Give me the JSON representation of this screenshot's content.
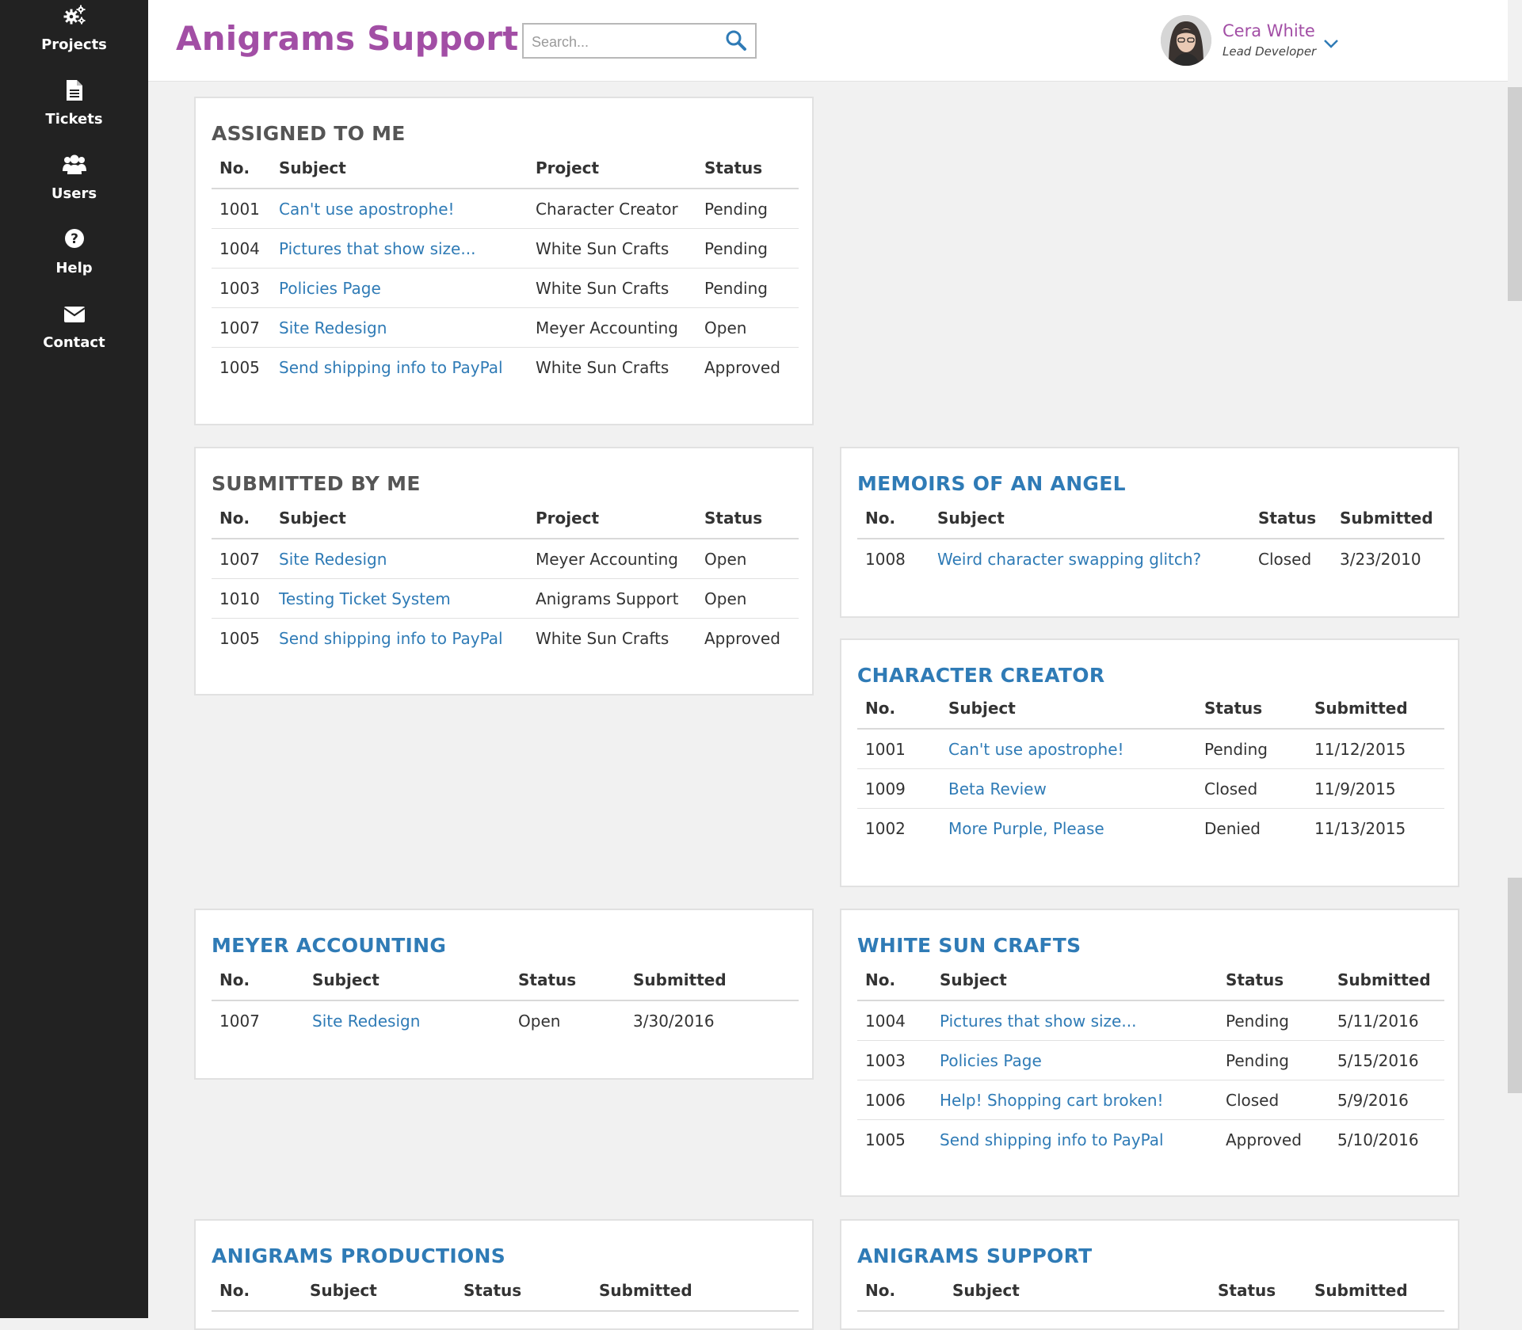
{
  "sidebar": {
    "items": [
      {
        "label": "Projects",
        "icon": "gears-icon"
      },
      {
        "label": "Tickets",
        "icon": "document-icon"
      },
      {
        "label": "Users",
        "icon": "users-icon"
      },
      {
        "label": "Help",
        "icon": "question-icon"
      },
      {
        "label": "Contact",
        "icon": "envelope-icon"
      }
    ]
  },
  "header": {
    "brand": "Anigrams Support",
    "search_placeholder": "Search...",
    "user_name": "Cera White",
    "user_role": "Lead Developer"
  },
  "colors": {
    "brand": "#a24ea5",
    "link": "#2f7bb6",
    "sidebar": "#222222"
  },
  "assigned": {
    "title": "ASSIGNED TO ME",
    "headers": [
      "No.",
      "Subject",
      "Project",
      "Status"
    ],
    "rows": [
      [
        "1001",
        "Can't use apostrophe!",
        "Character Creator",
        "Pending"
      ],
      [
        "1004",
        "Pictures that show size...",
        "White Sun Crafts",
        "Pending"
      ],
      [
        "1003",
        "Policies Page",
        "White Sun Crafts",
        "Pending"
      ],
      [
        "1007",
        "Site Redesign",
        "Meyer Accounting",
        "Open"
      ],
      [
        "1005",
        "Send shipping info to PayPal",
        "White Sun Crafts",
        "Approved"
      ]
    ]
  },
  "submitted": {
    "title": "SUBMITTED BY ME",
    "headers": [
      "No.",
      "Subject",
      "Project",
      "Status"
    ],
    "rows": [
      [
        "1007",
        "Site Redesign",
        "Meyer Accounting",
        "Open"
      ],
      [
        "1010",
        "Testing Ticket System",
        "Anigrams Support",
        "Open"
      ],
      [
        "1005",
        "Send shipping info to PayPal",
        "White Sun Crafts",
        "Approved"
      ]
    ]
  },
  "memoirs": {
    "title": "MEMOIRS OF AN ANGEL",
    "headers": [
      "No.",
      "Subject",
      "Status",
      "Submitted"
    ],
    "rows": [
      [
        "1008",
        "Weird character swapping glitch?",
        "Closed",
        "3/23/2010"
      ]
    ]
  },
  "character_creator": {
    "title": "CHARACTER CREATOR",
    "headers": [
      "No.",
      "Subject",
      "Status",
      "Submitted"
    ],
    "rows": [
      [
        "1001",
        "Can't use apostrophe!",
        "Pending",
        "11/12/2015"
      ],
      [
        "1009",
        "Beta Review",
        "Closed",
        "11/9/2015"
      ],
      [
        "1002",
        "More Purple, Please",
        "Denied",
        "11/13/2015"
      ]
    ]
  },
  "meyer": {
    "title": "MEYER ACCOUNTING",
    "headers": [
      "No.",
      "Subject",
      "Status",
      "Submitted"
    ],
    "rows": [
      [
        "1007",
        "Site Redesign",
        "Open",
        "3/30/2016"
      ]
    ]
  },
  "white_sun": {
    "title": "WHITE SUN CRAFTS",
    "headers": [
      "No.",
      "Subject",
      "Status",
      "Submitted"
    ],
    "rows": [
      [
        "1004",
        "Pictures that show size...",
        "Pending",
        "5/11/2016"
      ],
      [
        "1003",
        "Policies Page",
        "Pending",
        "5/15/2016"
      ],
      [
        "1006",
        "Help! Shopping cart broken!",
        "Closed",
        "5/9/2016"
      ],
      [
        "1005",
        "Send shipping info to PayPal",
        "Approved",
        "5/10/2016"
      ]
    ]
  },
  "productions": {
    "title": "ANIGRAMS PRODUCTIONS",
    "headers": [
      "No.",
      "Subject",
      "Status",
      "Submitted"
    ],
    "rows": []
  },
  "support": {
    "title": "ANIGRAMS SUPPORT",
    "headers": [
      "No.",
      "Subject",
      "Status",
      "Submitted"
    ],
    "rows": []
  }
}
